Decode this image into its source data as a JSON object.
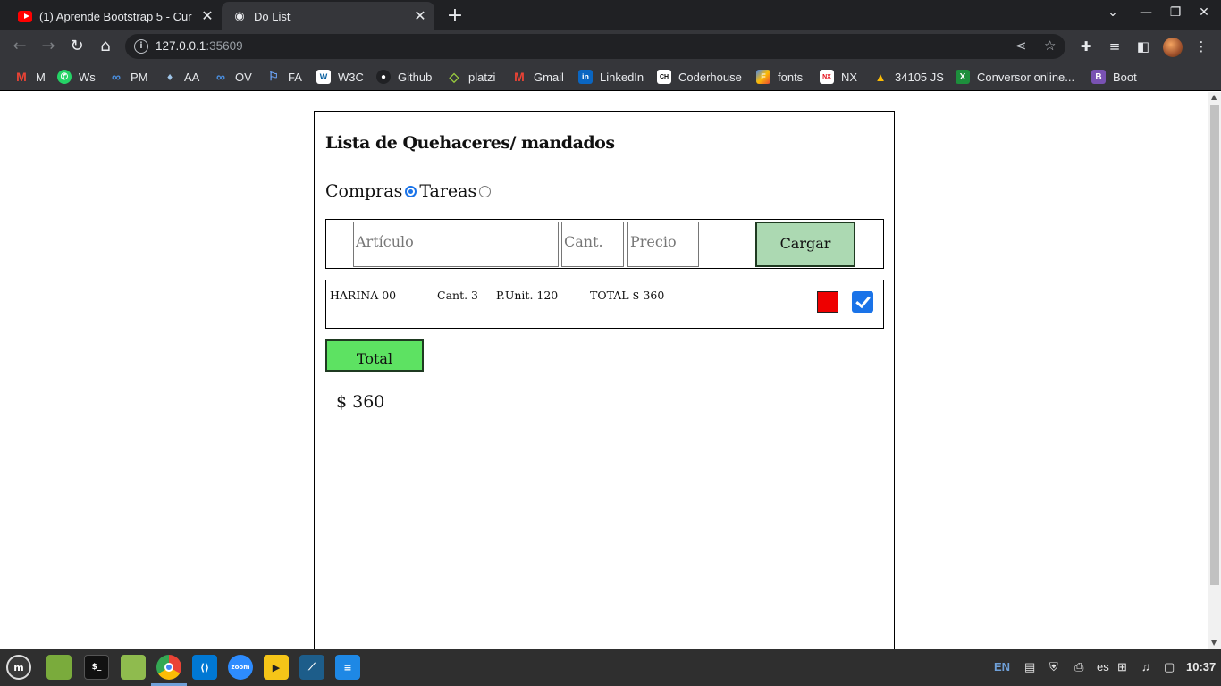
{
  "browser": {
    "tabs": [
      {
        "title": "(1) Aprende Bootstrap 5 - Cur",
        "active": false
      },
      {
        "title": "Do List",
        "active": true
      }
    ],
    "url_host": "127.0.0.1",
    "url_port": ":35609",
    "bookmarks": [
      {
        "label": "M",
        "icon": "gmail-icon"
      },
      {
        "label": "Ws",
        "icon": "whatsapp-icon"
      },
      {
        "label": "PM",
        "icon": "infinity-icon"
      },
      {
        "label": "AA",
        "icon": "seal-icon"
      },
      {
        "label": "OV",
        "icon": "infinity-icon"
      },
      {
        "label": "FA",
        "icon": "flag-icon"
      },
      {
        "label": "W3C",
        "icon": "w3c-icon"
      },
      {
        "label": "Github",
        "icon": "github-icon"
      },
      {
        "label": "platzi",
        "icon": "platzi-icon"
      },
      {
        "label": "Gmail",
        "icon": "gmail-icon"
      },
      {
        "label": "LinkedIn",
        "icon": "linkedin-icon"
      },
      {
        "label": "Coderhouse",
        "icon": "coderhouse-icon"
      },
      {
        "label": "fonts",
        "icon": "fonts-icon"
      },
      {
        "label": "NX",
        "icon": "nx-icon"
      },
      {
        "label": "34105 JS",
        "icon": "drive-icon"
      },
      {
        "label": "Conversor online...",
        "icon": "excel-icon"
      },
      {
        "label": "Boot",
        "icon": "bootstrap-icon"
      }
    ]
  },
  "page": {
    "heading": "Lista de Quehaceres/ mandados",
    "radio_compras": "Compras",
    "radio_tareas": "Tareas",
    "selected_mode": "Compras",
    "form": {
      "articulo_placeholder": "Artículo",
      "cant_placeholder": "Cant.",
      "precio_placeholder": "Precio",
      "cargar_label": "Cargar"
    },
    "items": [
      {
        "nombre": "HARINA 00",
        "cant": "Cant. 3",
        "punit": "P.Unit. 120",
        "total": "TOTAL $ 360",
        "done": true
      }
    ],
    "total_button": "Total",
    "total_value": "$ 360"
  },
  "taskbar": {
    "lang": "EN",
    "kb": "es",
    "clock": "10:37"
  },
  "colors": {
    "cargar_bg": "#acd9b2",
    "total_bg": "#5de262",
    "delete_bg": "#ee0000",
    "check_bg": "#1a73e8"
  }
}
